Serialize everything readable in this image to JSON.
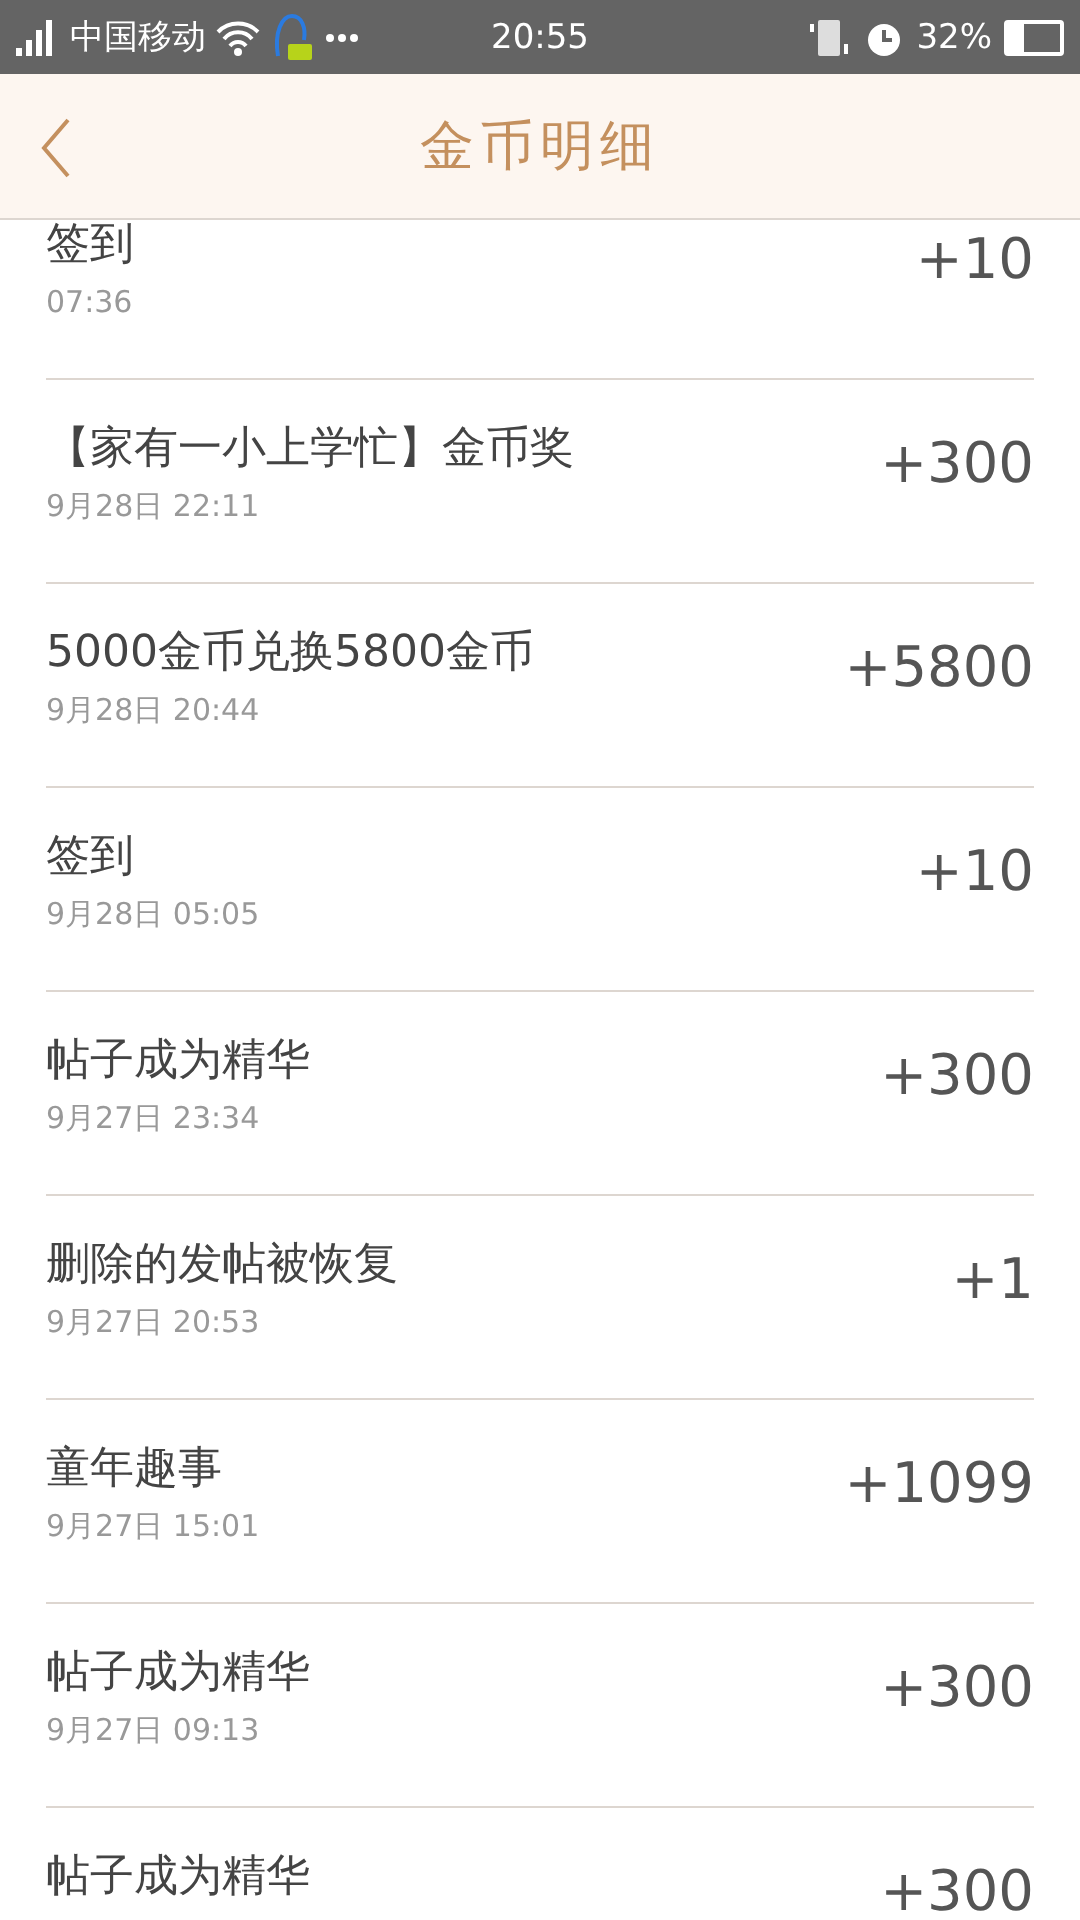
{
  "status_bar": {
    "carrier": "中国移动",
    "time": "20:55",
    "battery_text": "32%"
  },
  "header": {
    "title": "金币明细"
  },
  "records": [
    {
      "title": "签到",
      "time": "07:36",
      "amount": "+10"
    },
    {
      "title": "【家有一小上学忙】金币奖",
      "time": "9月28日 22:11",
      "amount": "+300"
    },
    {
      "title": "5000金币兑换5800金币",
      "time": "9月28日 20:44",
      "amount": "+5800"
    },
    {
      "title": "签到",
      "time": "9月28日 05:05",
      "amount": "+10"
    },
    {
      "title": "帖子成为精华",
      "time": "9月27日 23:34",
      "amount": "+300"
    },
    {
      "title": "删除的发帖被恢复",
      "time": "9月27日 20:53",
      "amount": "+1"
    },
    {
      "title": "童年趣事",
      "time": "9月27日 15:01",
      "amount": "+1099"
    },
    {
      "title": "帖子成为精华",
      "time": "9月27日 09:13",
      "amount": "+300"
    },
    {
      "title": "帖子成为精华",
      "amount": "+300"
    }
  ]
}
